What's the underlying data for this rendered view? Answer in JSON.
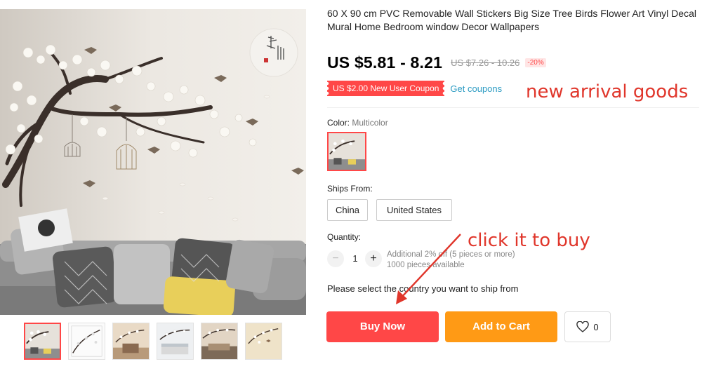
{
  "product": {
    "title": "60 X 90 cm PVC Removable Wall Stickers Big Size Tree Birds Flower Art Vinyl Decal Mural Home Bedroom window Decor Wallpapers",
    "price": "US $5.81 - 8.21",
    "old_price": "US $7.26 - 10.26",
    "discount": "-20%"
  },
  "coupon": {
    "label": "US $2.00 New User Coupon",
    "link": "Get coupons"
  },
  "annotations": {
    "new_arrival": "new arrival goods",
    "click_to_buy": "click it to buy"
  },
  "color": {
    "label": "Color:",
    "value": "Multicolor"
  },
  "ships_from": {
    "label": "Ships From:",
    "options": [
      "China",
      "United States"
    ]
  },
  "quantity": {
    "label": "Quantity:",
    "value": "1",
    "minus": "−",
    "plus": "+",
    "discount_note": "Additional 2% off (5 pieces or more)",
    "available": "1000 pieces available"
  },
  "ship_note": "Please select the country you want to ship from",
  "actions": {
    "buy_now": "Buy Now",
    "add_to_cart": "Add to Cart",
    "wishlist_count": "0"
  },
  "gallery": {
    "thumbnail_count": 6,
    "active_index": 0
  },
  "colors": {
    "accent_red": "#ff4747",
    "accent_orange": "#ff9a15",
    "link_blue": "#2e9cc3",
    "annotation_red": "#e0362b"
  },
  "icons": {
    "heart": "heart-icon",
    "arrow": "arrow-annotation-icon"
  }
}
